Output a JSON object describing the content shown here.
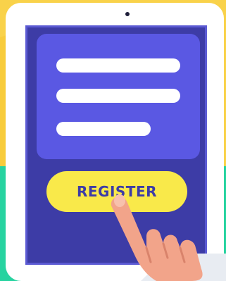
{
  "register_button": {
    "label": "REGISTER"
  },
  "form": {
    "fields": [
      {
        "name": "field-1",
        "value": ""
      },
      {
        "name": "field-2",
        "value": ""
      },
      {
        "name": "field-3",
        "value": ""
      }
    ]
  },
  "colors": {
    "background_top": "#f9d24a",
    "background_bottom": "#27d3a0",
    "tablet_frame": "#ffffff",
    "screen": "#3d3ca6",
    "form_card": "#5a58e3",
    "field": "#ffffff",
    "button": "#f9e94a",
    "button_text": "#3d3ca6",
    "skin": "#f2a48a"
  },
  "icons": {
    "hand": "pointing-hand-icon",
    "camera": "camera-dot-icon"
  }
}
